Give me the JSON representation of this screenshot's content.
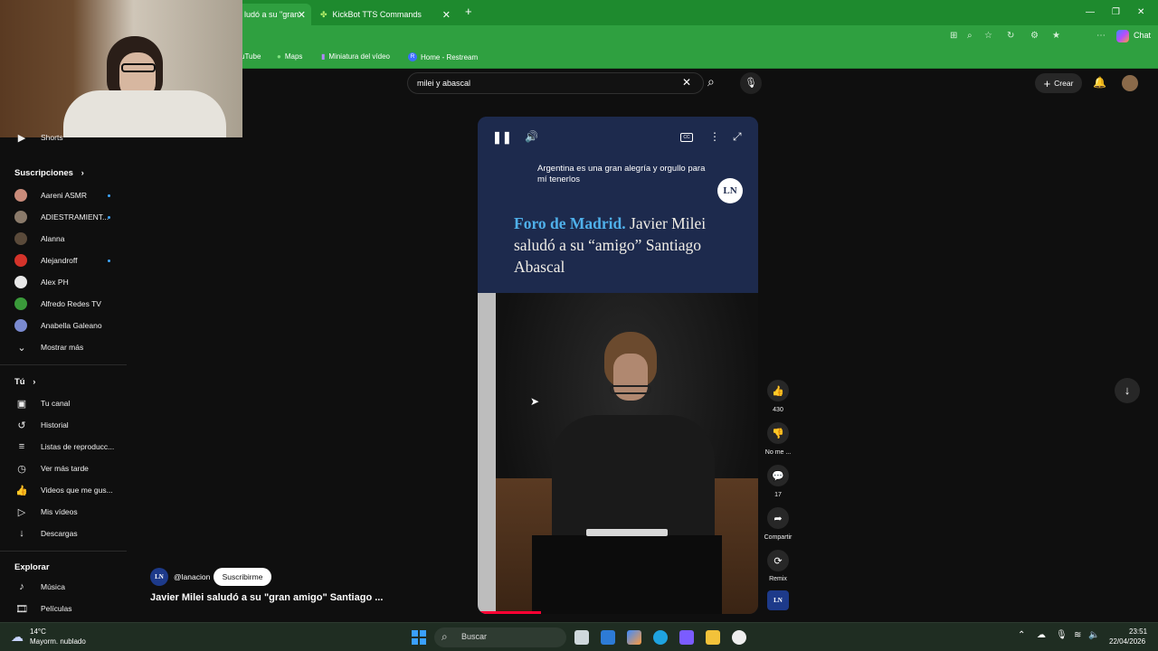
{
  "browser": {
    "tabs": [
      {
        "label": "ludó a su \"gran"
      },
      {
        "label": "KickBot TTS Commands"
      }
    ],
    "chat_label": "Chat",
    "bookmarks": [
      "uTube",
      "Maps",
      "Miniatura del vídeo",
      "Home - Restream"
    ]
  },
  "header": {
    "search_value": "milei y abascal",
    "create_label": "Crear"
  },
  "sidebar": {
    "shorts_label": "Shorts",
    "subscriptions_header": "Suscripciones",
    "subscriptions": [
      {
        "label": "Aareni ASMR",
        "color": "#c98b7a",
        "dot": true
      },
      {
        "label": "ADIESTRAMIENT...",
        "color": "#8a7a6a",
        "dot": true
      },
      {
        "label": "Alanna",
        "color": "#5a4a3a",
        "dot": false
      },
      {
        "label": "Alejandroff",
        "color": "#d4332a",
        "dot": true
      },
      {
        "label": "Alex PH",
        "color": "#e8e8e8",
        "dot": false
      },
      {
        "label": "Alfredo Redes TV",
        "color": "#3a9a3a",
        "dot": false
      },
      {
        "label": "Anabella Galeano",
        "color": "#7a8ad0",
        "dot": false
      }
    ],
    "show_more_label": "Mostrar más",
    "you_header": "Tú",
    "you_items": [
      {
        "label": "Tu canal",
        "icon": "person-box-icon"
      },
      {
        "label": "Historial",
        "icon": "history-icon"
      },
      {
        "label": "Listas de reproducc...",
        "icon": "playlist-icon"
      },
      {
        "label": "Ver más tarde",
        "icon": "clock-icon"
      },
      {
        "label": "Videos que me gus...",
        "icon": "thumbs-up-icon"
      },
      {
        "label": "Mis vídeos",
        "icon": "video-icon"
      },
      {
        "label": "Descargas",
        "icon": "download-icon"
      }
    ],
    "explore_header": "Explorar",
    "explore_items": [
      {
        "label": "Música",
        "icon": "music-icon"
      },
      {
        "label": "Películas",
        "icon": "film-icon"
      }
    ]
  },
  "video": {
    "caption": "Argentina es una gran alegría y orgullo para mí tenerlos",
    "logo": "LN",
    "headline_highlight": "Foro de Madrid.",
    "headline_rest": " Javier Milei saludó a su “amigo” Santiago Abascal",
    "channel_handle": "@lanacion",
    "channel_avatar": "LN",
    "subscribe_label": "Suscribirme",
    "title": "Javier Milei saludó a su \"gran amigo\" Santiago ..."
  },
  "actions": {
    "likes": "430",
    "dislike_label": "No me ...",
    "comments": "17",
    "share_label": "Compartir",
    "remix_label": "Remix",
    "channel_badge": "LN"
  },
  "taskbar": {
    "weather_temp": "14°C",
    "weather_desc": "Mayorm. nublado",
    "search_placeholder": "Buscar",
    "time": "23:51",
    "date": "22/04/2026"
  }
}
